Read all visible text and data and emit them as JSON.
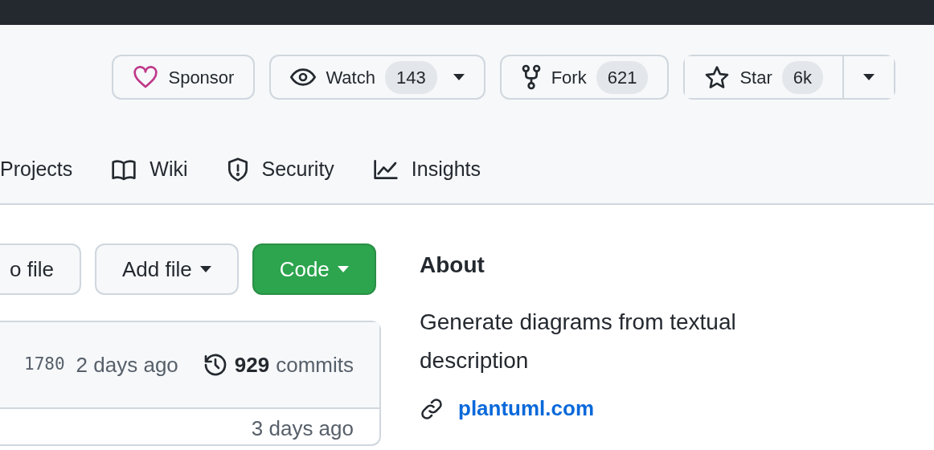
{
  "actions": [
    {
      "kind": "sponsor",
      "label": "Sponsor"
    },
    {
      "kind": "watch",
      "label": "Watch",
      "count": "143",
      "dropdown": true
    },
    {
      "kind": "fork",
      "label": "Fork",
      "count": "621",
      "dropdown": false
    },
    {
      "kind": "star",
      "label": "Star",
      "count": "6k",
      "dropdown": true
    }
  ],
  "tabs": [
    {
      "kind": "projects",
      "label": "Projects",
      "selected": false
    },
    {
      "kind": "wiki",
      "label": "Wiki",
      "selected": false
    },
    {
      "kind": "security",
      "label": "Security",
      "selected": false
    },
    {
      "kind": "insights",
      "label": "Insights",
      "selected": false
    }
  ],
  "file_buttons": [
    {
      "kind": "plain",
      "label": "o file",
      "dropdown": false
    },
    {
      "kind": "plain",
      "label": "Add file",
      "dropdown": true
    },
    {
      "kind": "primary",
      "label": "Code",
      "dropdown": true
    }
  ],
  "commit_box": {
    "hash": "1780",
    "time": "2 days ago",
    "commits_count": "929",
    "commits_label": "commits",
    "rows": [
      {
        "time": "3 days ago"
      }
    ]
  },
  "about": {
    "title": "About",
    "description": "Generate diagrams from textual description",
    "link": "plantuml.com"
  }
}
